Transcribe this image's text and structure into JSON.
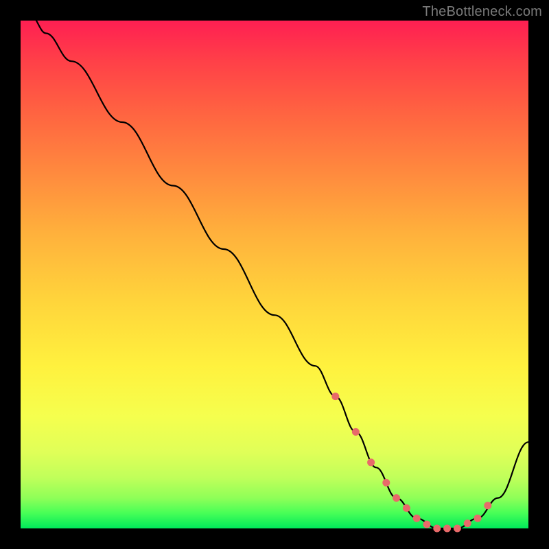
{
  "watermark": "TheBottleneck.com",
  "chart_data": {
    "type": "line",
    "title": "",
    "xlabel": "",
    "ylabel": "",
    "xlim": [
      0,
      100
    ],
    "ylim": [
      0,
      100
    ],
    "series": [
      {
        "name": "bottleneck-curve",
        "x": [
          2,
          5,
          10,
          20,
          30,
          40,
          50,
          58,
          62,
          66,
          70,
          74,
          78,
          82,
          86,
          90,
          94,
          100
        ],
        "y": [
          101,
          97.5,
          92,
          80,
          67.5,
          55,
          42,
          32,
          26,
          19,
          12,
          6,
          2,
          0,
          0,
          2,
          6,
          17
        ]
      }
    ],
    "markers": {
      "name": "highlight-dots",
      "color": "#e86a6a",
      "x": [
        62,
        66,
        69,
        72,
        74,
        76,
        78,
        80,
        82,
        84,
        86,
        88,
        90,
        92
      ],
      "y": [
        26,
        19,
        13,
        9,
        6,
        4,
        2,
        0.8,
        0,
        0,
        0,
        1,
        2,
        4.5
      ]
    }
  }
}
